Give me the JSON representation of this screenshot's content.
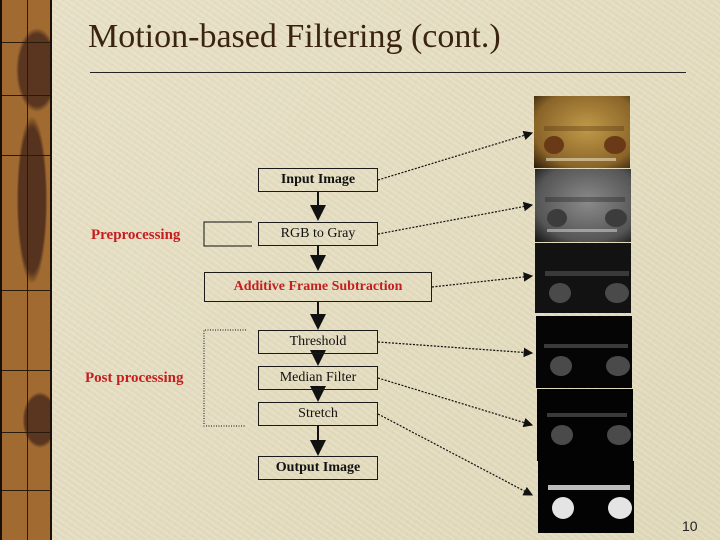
{
  "slide": {
    "title": "Motion-based Filtering (cont.)",
    "page_number": "10"
  },
  "groups": {
    "preprocessing": "Preprocessing",
    "post_processing": "Post processing"
  },
  "steps": [
    {
      "id": "input",
      "label": "Input Image"
    },
    {
      "id": "rgb",
      "label": "RGB to Gray"
    },
    {
      "id": "additive",
      "label": "Additive Frame Subtraction"
    },
    {
      "id": "threshold",
      "label": "Threshold"
    },
    {
      "id": "median",
      "label": "Median Filter"
    },
    {
      "id": "stretch",
      "label": "Stretch"
    },
    {
      "id": "output",
      "label": "Output Image"
    }
  ],
  "thumbnails": [
    {
      "name": "input-frame",
      "tone": "sepia"
    },
    {
      "name": "gray-frame",
      "tone": "gray"
    },
    {
      "name": "subtracted-frame",
      "tone": "dark"
    },
    {
      "name": "threshold-frame",
      "tone": "dark"
    },
    {
      "name": "median-frame",
      "tone": "dark"
    },
    {
      "name": "output-frame",
      "tone": "bright"
    }
  ],
  "colors": {
    "accent_red": "#c41e1e",
    "title_brown": "#3a2410"
  }
}
